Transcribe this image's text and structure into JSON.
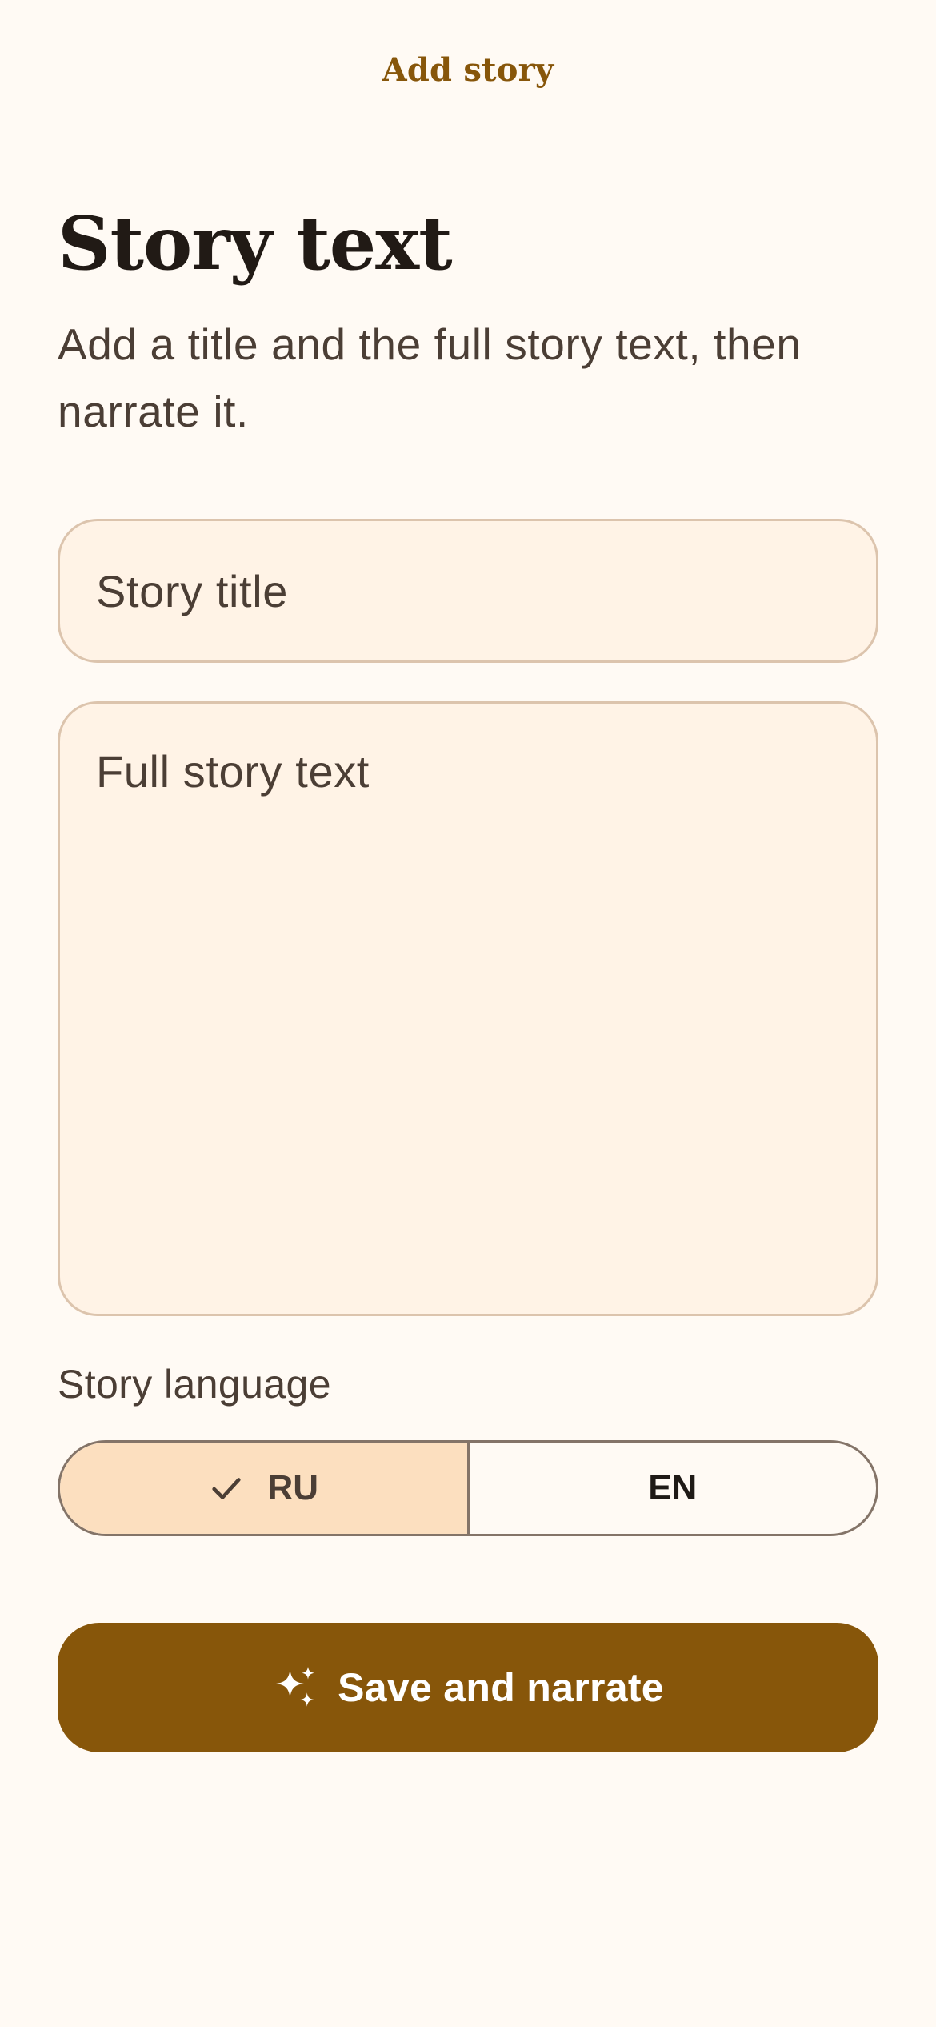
{
  "header": {
    "title": "Add story"
  },
  "main": {
    "heading": "Story text",
    "subtitle": "Add a title and the full story text, then narrate it."
  },
  "form": {
    "title_input": {
      "value": "",
      "placeholder": "Story title"
    },
    "text_input": {
      "value": "",
      "placeholder": "Full story text"
    },
    "language": {
      "label": "Story language",
      "options": [
        {
          "label": "RU",
          "selected": true
        },
        {
          "label": "EN",
          "selected": false
        }
      ]
    },
    "submit": {
      "label": "Save and narrate",
      "icon": "sparkle-icon"
    }
  },
  "colors": {
    "background": "#fffaf4",
    "accent": "#87560a",
    "field_background": "#fff3e6",
    "selected_segment": "#fcdfbf"
  }
}
